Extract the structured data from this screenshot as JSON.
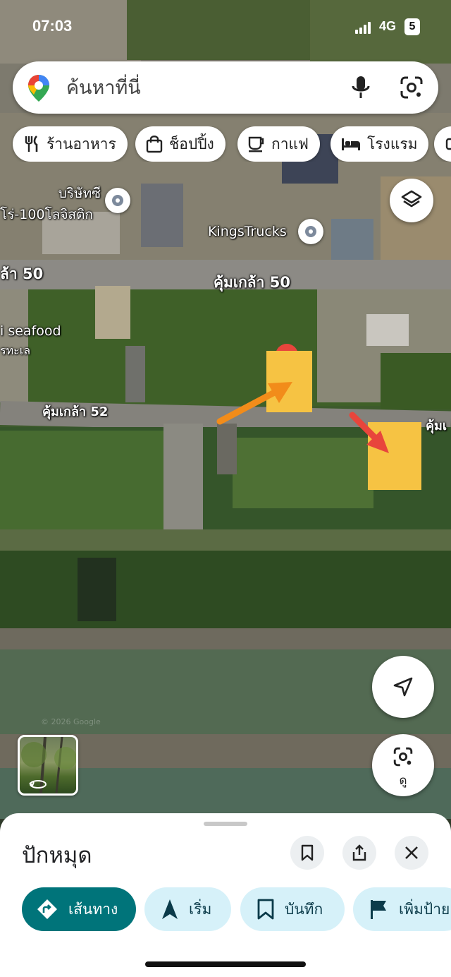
{
  "status_bar": {
    "time": "07:03",
    "network": "4G",
    "battery": "5"
  },
  "search": {
    "placeholder": "ค้นหาที่นี่"
  },
  "chips": [
    {
      "label": "ร้านอาหาร",
      "icon": "fork-knife-icon"
    },
    {
      "label": "ช็อปปิ้ง",
      "icon": "shopping-bag-icon"
    },
    {
      "label": "กาแฟ",
      "icon": "coffee-cup-icon"
    },
    {
      "label": "โรงแรม",
      "icon": "bed-icon"
    }
  ],
  "map": {
    "labels": {
      "company_line1": "บริษัทซี",
      "company_line2": "โร่-100โลจิสติก",
      "kingstrucks": "KingsTrucks",
      "road_50_left": "ล้า 50",
      "road_50_main": "คุ้มเกล้า 50",
      "seafood_line1": "i seafood",
      "seafood_line2": "รทะเล",
      "road_52": "คุ้มเกล้า 52",
      "road_right": "คุ้มเ",
      "watermark": "© 2026 Google"
    },
    "annotation_colors": {
      "box": "#f6c343",
      "arrow_orange": "#f28c1a",
      "arrow_red": "#e8453c"
    }
  },
  "buttons": {
    "view_label": "ดู"
  },
  "sheet": {
    "title": "ปักหมุด",
    "actions": {
      "route": "เส้นทาง",
      "start": "เริ่ม",
      "save": "บันทึก",
      "label": "เพิ่มป้าย"
    }
  },
  "colors": {
    "route_button": "#00747a",
    "secondary_button": "#d6f1f9"
  }
}
